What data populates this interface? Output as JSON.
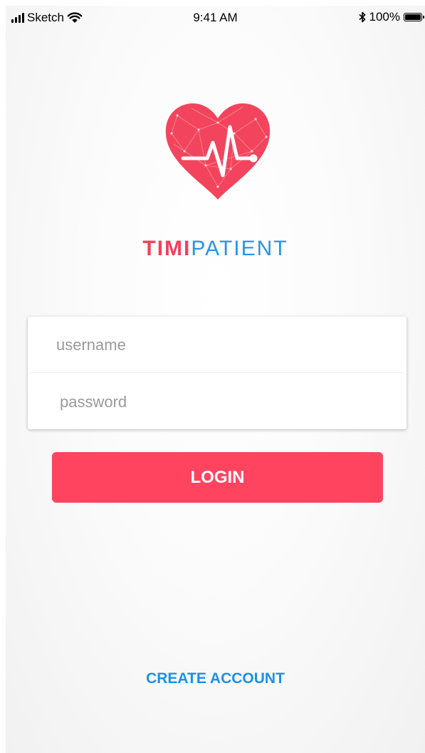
{
  "status_bar": {
    "carrier": "Sketch",
    "time": "9:41 AM",
    "battery_percent": "100%"
  },
  "brand": {
    "name_part_a": "TIMI",
    "name_part_b": "PATIENT",
    "primary_color": "#f4405a",
    "secondary_color": "#2b93e6"
  },
  "login_form": {
    "username_placeholder": "username",
    "password_placeholder": "password",
    "login_label": "LOGIN"
  },
  "footer": {
    "create_account_label": "CREATE ACCOUNT"
  },
  "icons": {
    "logo": "heart-pulse-icon",
    "signal": "signal-bars-icon",
    "wifi": "wifi-icon",
    "bluetooth": "bluetooth-icon",
    "battery": "battery-icon"
  }
}
